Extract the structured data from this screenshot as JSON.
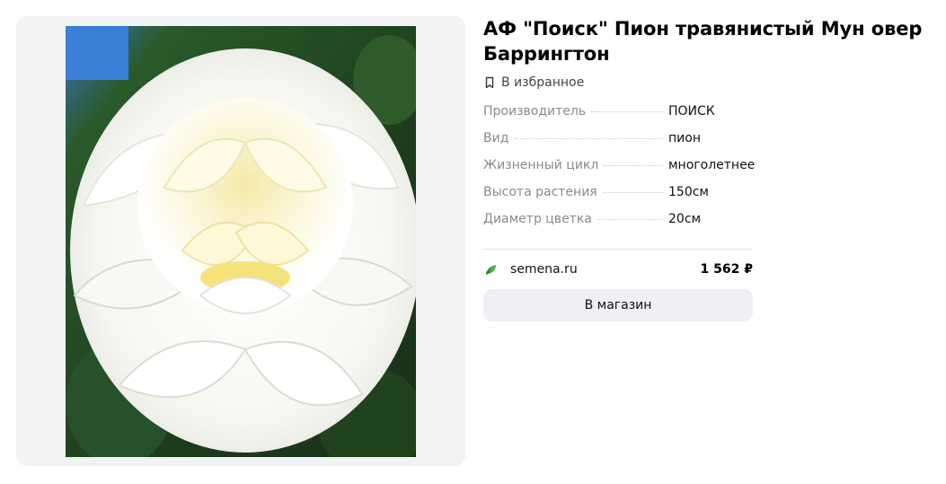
{
  "product": {
    "title": "АФ \"Поиск\" Пион травянистый Мун овер Баррингтон",
    "image_alt": "white-peony-photo"
  },
  "favorite": {
    "label": "В избранное",
    "icon": "bookmark-icon"
  },
  "specs": [
    {
      "label": "Производитель",
      "value": "ПОИСК"
    },
    {
      "label": "Вид",
      "value": "пион"
    },
    {
      "label": "Жизненный цикл",
      "value": "многолетнее"
    },
    {
      "label": "Высота растения",
      "value": "150см"
    },
    {
      "label": "Диаметр цветка",
      "value": "20см"
    }
  ],
  "offer": {
    "shop_icon": "leaf-icon",
    "shop_name": "semena.ru",
    "price": "1 562 ₽"
  },
  "actions": {
    "shop_button_label": "В магазин"
  },
  "colors": {
    "panel_background": "#f2f3f5",
    "button_background": "#eef0f3",
    "label_gray": "#8a8a8a",
    "leaf_green": "#4caf50"
  }
}
